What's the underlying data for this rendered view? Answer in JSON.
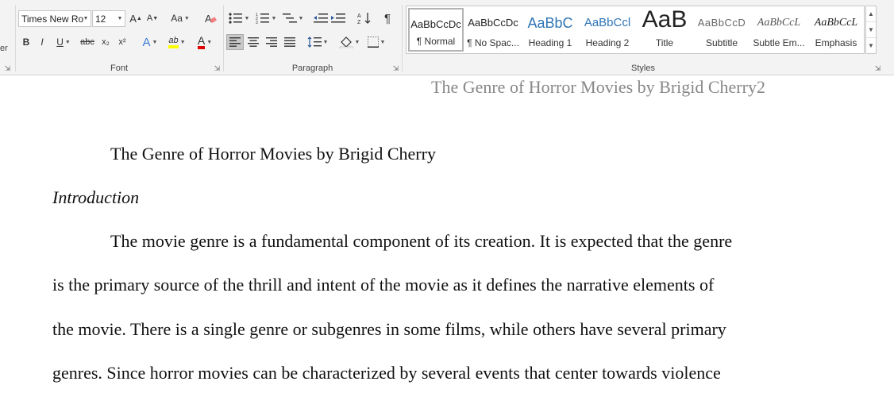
{
  "ribbon": {
    "clipboard_partial_label": "er",
    "font": {
      "group_label": "Font",
      "font_name": "Times New Ro",
      "font_size": "12",
      "grow_label": "A",
      "shrink_label": "A",
      "change_case_label": "Aa",
      "bold_label": "B",
      "italic_label": "I",
      "underline_label": "U",
      "strike_label": "abc",
      "subscript_label": "x₂",
      "superscript_label": "x²",
      "text_effects_label": "A",
      "highlight_label": "ab",
      "font_color_label": "A"
    },
    "paragraph": {
      "group_label": "Paragraph"
    },
    "styles": {
      "group_label": "Styles",
      "items": [
        {
          "preview": "AaBbCcDc",
          "name": "¶ Normal"
        },
        {
          "preview": "AaBbCcDc",
          "name": "¶ No Spac..."
        },
        {
          "preview": "AaBbC",
          "name": "Heading 1"
        },
        {
          "preview": "AaBbCcl",
          "name": "Heading 2"
        },
        {
          "preview": "AaB",
          "name": "Title"
        },
        {
          "preview": "AaBbCcD",
          "name": "Subtitle"
        },
        {
          "preview": "AaBbCcL",
          "name": "Subtle Em..."
        },
        {
          "preview": "AaBbCcL",
          "name": "Emphasis"
        }
      ]
    },
    "colors": {
      "highlight": "#ffff00",
      "font_color": "#e00000",
      "heading_blue": "#2e74b5",
      "effects_blue": "#3a7bd5"
    }
  },
  "document": {
    "header": "The Genre of Horror Movies by Brigid Cherry2",
    "title": "The Genre of Horror Movies by Brigid Cherry",
    "section_heading": "Introduction",
    "paragraph_lines": [
      "The movie genre is a fundamental component of its creation. It is expected that the genre",
      "is the primary source of the thrill and intent of the movie as it defines the narrative elements of",
      "the movie. There is a single genre or subgenres in some films, while others have several primary",
      "genres. Since horror movies can be characterized by several events that center towards violence"
    ]
  }
}
